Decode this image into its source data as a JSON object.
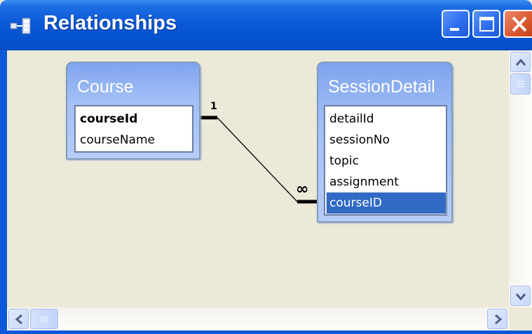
{
  "window": {
    "title": "Relationships",
    "icon": "relationships-icon",
    "controls": [
      "minimize-icon",
      "maximize-icon",
      "close-icon"
    ]
  },
  "tables": [
    {
      "name": "Course",
      "fields": [
        {
          "label": "courseId",
          "primary_key": true
        },
        {
          "label": "courseName",
          "primary_key": false
        }
      ]
    },
    {
      "name": "SessionDetail",
      "fields": [
        {
          "label": "detailId",
          "primary_key": false
        },
        {
          "label": "sessionNo",
          "primary_key": false
        },
        {
          "label": "topic",
          "primary_key": false
        },
        {
          "label": "assignment",
          "primary_key": false
        },
        {
          "label": "courseID",
          "primary_key": false,
          "selected": true
        }
      ]
    }
  ],
  "relationship": {
    "from_table": "Course",
    "from_field": "courseId",
    "to_table": "SessionDetail",
    "to_field": "courseID",
    "one_label": "1",
    "many_label": "∞"
  },
  "scrollbars": {
    "vertical": [
      "scroll-up-icon",
      "scroll-down-icon"
    ],
    "horizontal": [
      "scroll-left-icon",
      "scroll-right-icon"
    ]
  },
  "colors": {
    "title_bar": "#0c58d8",
    "table_header": "#a3bff5",
    "selection": "#316ac5",
    "canvas": "#ece9d8"
  }
}
